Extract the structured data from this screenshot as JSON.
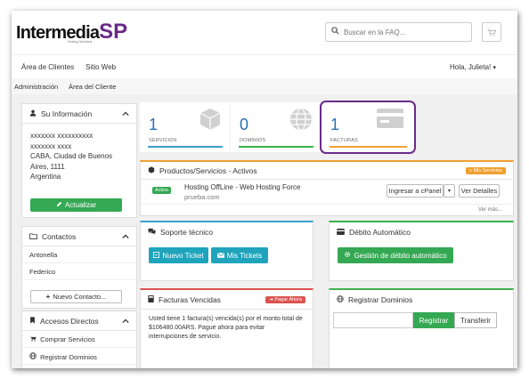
{
  "header": {
    "logo_main": "Intermedia",
    "logo_sp": "SP",
    "logo_sub": "Hosting Solutions",
    "search_placeholder": "Buscar en la FAQ...",
    "search_icon": "search-icon",
    "cart_icon": "cart-icon"
  },
  "nav": {
    "items": [
      "Área de Clientes",
      "Sitio Web"
    ],
    "greeting": "Hola, Julieta!",
    "greeting_caret": "▾"
  },
  "breadcrumb": {
    "items": [
      "Administración",
      "Área del Cliente"
    ]
  },
  "sidebar": {
    "info": {
      "title": "Su Información",
      "lines": [
        "xxxxxxx xxxxxxxxxx",
        "xxxxxxx xxxx",
        "CABA, Ciudad de Buenos",
        "Aires, 1111",
        "Argentina"
      ],
      "update_button": "Actualizar"
    },
    "contacts": {
      "title": "Contactos",
      "items": [
        "Antonella",
        "Federico"
      ],
      "new_button": "Nuevo Contacto..."
    },
    "shortcuts": {
      "title": "Accesos Directos",
      "items": [
        "Comprar Servicios",
        "Registrar Dominios"
      ]
    }
  },
  "stats": [
    {
      "value": "1",
      "label": "SERVICIOS",
      "color": "#3aa0d0"
    },
    {
      "value": "0",
      "label": "DOMINIOS",
      "color": "#3cb14a"
    },
    {
      "value": "1",
      "label": "FACTURAS",
      "color": "#f0a030"
    }
  ],
  "products": {
    "title": "Productos/Servicios - Activos",
    "badge": "Mis Servicios",
    "item_status": "Activo",
    "item_name": "Hosting OffLine - Web Hosting Force",
    "item_domain": "prueba.com",
    "cpanel_button": "Ingresar a cPanel",
    "details_button": "Ver Detalles",
    "more": "Ver más..."
  },
  "support": {
    "title": "Soporte técnico",
    "new_ticket": "Nuevo Ticket",
    "my_tickets": "Mis Tickets"
  },
  "debit": {
    "title": "Débito Automático",
    "button": "Gestión de débito automático"
  },
  "invoices": {
    "title": "Facturas Vencidas",
    "badge": "Pagar Ahora",
    "text": "Usted tiene 1 factura(s) vencida(s) por el monto total de $106480.00ARS. Pague ahora para evitar interrupciones de servicio."
  },
  "domains": {
    "title": "Registrar Dominios",
    "register": "Registrar",
    "transfer": "Transferir"
  },
  "colors": {
    "accent_blue": "#2a6fb5",
    "green": "#34a853",
    "teal": "#1fa4bc",
    "red": "#d9534f",
    "orange": "#f0a030",
    "highlight": "#6a2a8a"
  }
}
